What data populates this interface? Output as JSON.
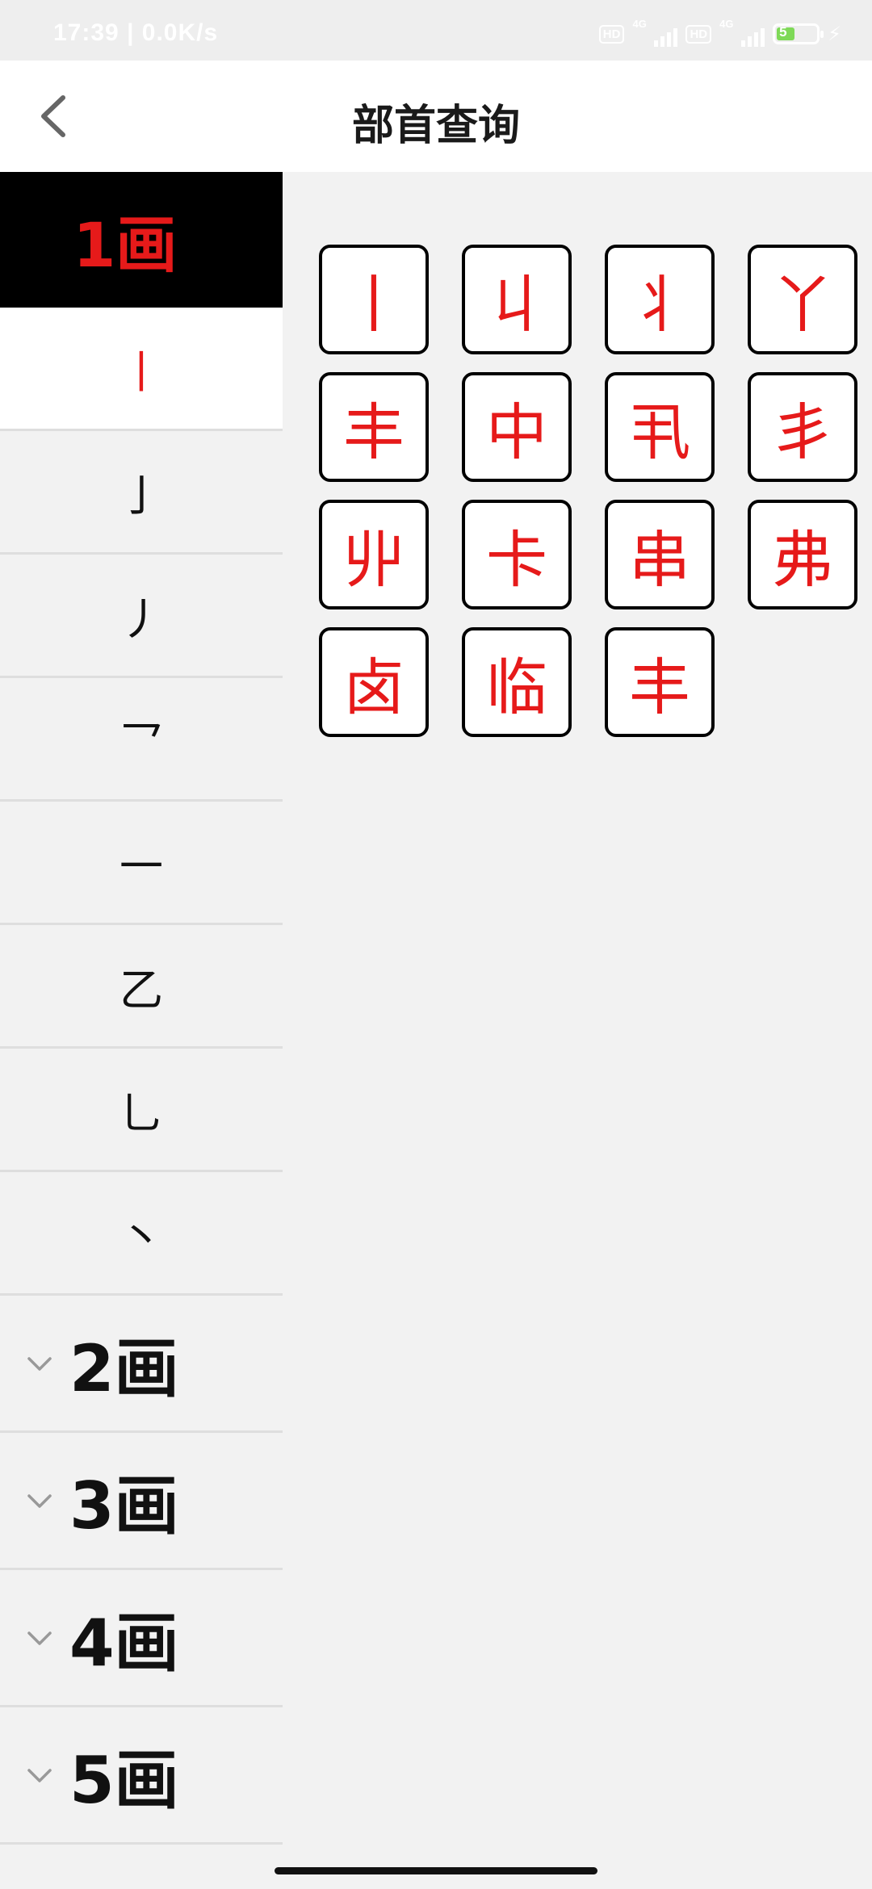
{
  "status_bar": {
    "time_speed": "17:39 | 0.0K/s",
    "sim1_hd": "HD",
    "sim1_net": "4G",
    "sim2_hd": "HD",
    "sim2_net": "4G",
    "battery_level": "5",
    "battery_color": "#7ed957"
  },
  "app_bar": {
    "title": "部首查询",
    "back_icon": "chevron-left-icon"
  },
  "sidebar": {
    "active_group": "1画",
    "radicals": [
      "丨",
      "亅",
      "丿",
      "乛",
      "一",
      "乙",
      "乚",
      "丶"
    ],
    "selected_radical": "丨",
    "collapsed_groups": [
      "2画",
      "3画",
      "4画",
      "5画"
    ]
  },
  "characters": [
    "丨",
    "丩",
    "丬",
    "丫",
    "丰",
    "中",
    "丮",
    "丯",
    "丱",
    "卡",
    "串",
    "弗",
    "卤",
    "临",
    "丰"
  ],
  "colors": {
    "accent_red": "#e61a1a",
    "header_black": "#000000",
    "background": "#f2f2f2"
  }
}
